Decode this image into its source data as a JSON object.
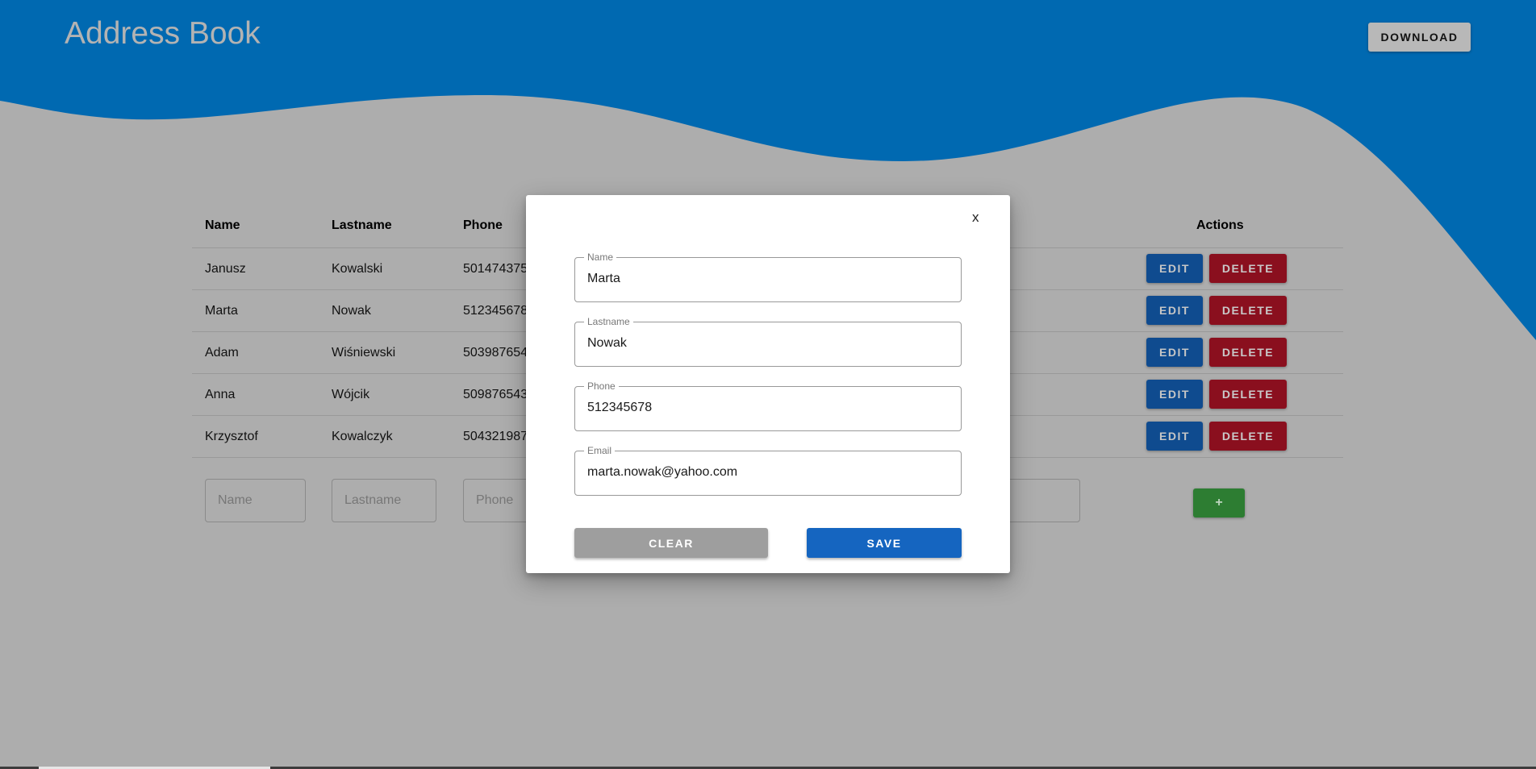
{
  "header": {
    "title": "Address Book",
    "download_label": "DOWNLOAD"
  },
  "table": {
    "columns": [
      "Name",
      "Lastname",
      "Phone",
      "Actions"
    ],
    "rows": [
      {
        "name": "Janusz",
        "lastname": "Kowalski",
        "phone": "501474375"
      },
      {
        "name": "Marta",
        "lastname": "Nowak",
        "phone": "512345678"
      },
      {
        "name": "Adam",
        "lastname": "Wiśniewski",
        "phone": "503987654"
      },
      {
        "name": "Anna",
        "lastname": "Wójcik",
        "phone": "509876543"
      },
      {
        "name": "Krzysztof",
        "lastname": "Kowalczyk",
        "phone": "504321987"
      }
    ],
    "edit_label": "EDIT",
    "delete_label": "DELETE"
  },
  "add_form": {
    "name_placeholder": "Name",
    "lastname_placeholder": "Lastname",
    "phone_placeholder": "Phone",
    "add_label": "+"
  },
  "modal": {
    "close_label": "x",
    "fields": [
      {
        "label": "Name",
        "value": "Marta"
      },
      {
        "label": "Lastname",
        "value": "Nowak"
      },
      {
        "label": "Phone",
        "value": "512345678"
      },
      {
        "label": "Email",
        "value": "marta.nowak@yahoo.com"
      }
    ],
    "clear_label": "CLEAR",
    "save_label": "SAVE"
  },
  "colors": {
    "header_blue": "#0069b1",
    "overlay_gray": "#adadad",
    "edit_blue": "#0f4b8f",
    "delete_red": "#8a0f1e",
    "add_green": "#2d7d32",
    "save_blue": "#1565c0",
    "clear_gray": "#9e9e9e"
  }
}
